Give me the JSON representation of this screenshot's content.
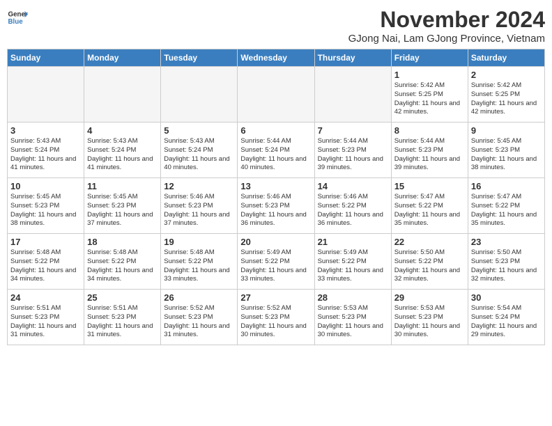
{
  "header": {
    "logo_line1": "General",
    "logo_line2": "Blue",
    "month": "November 2024",
    "location": "GJong Nai, Lam GJong Province, Vietnam"
  },
  "weekdays": [
    "Sunday",
    "Monday",
    "Tuesday",
    "Wednesday",
    "Thursday",
    "Friday",
    "Saturday"
  ],
  "weeks": [
    [
      {
        "day": "",
        "empty": true
      },
      {
        "day": "",
        "empty": true
      },
      {
        "day": "",
        "empty": true
      },
      {
        "day": "",
        "empty": true
      },
      {
        "day": "",
        "empty": true
      },
      {
        "day": "1",
        "sunrise": "5:42 AM",
        "sunset": "5:25 PM",
        "daylight": "11 hours and 42 minutes."
      },
      {
        "day": "2",
        "sunrise": "5:42 AM",
        "sunset": "5:25 PM",
        "daylight": "11 hours and 42 minutes."
      }
    ],
    [
      {
        "day": "3",
        "sunrise": "5:43 AM",
        "sunset": "5:24 PM",
        "daylight": "11 hours and 41 minutes."
      },
      {
        "day": "4",
        "sunrise": "5:43 AM",
        "sunset": "5:24 PM",
        "daylight": "11 hours and 41 minutes."
      },
      {
        "day": "5",
        "sunrise": "5:43 AM",
        "sunset": "5:24 PM",
        "daylight": "11 hours and 40 minutes."
      },
      {
        "day": "6",
        "sunrise": "5:44 AM",
        "sunset": "5:24 PM",
        "daylight": "11 hours and 40 minutes."
      },
      {
        "day": "7",
        "sunrise": "5:44 AM",
        "sunset": "5:23 PM",
        "daylight": "11 hours and 39 minutes."
      },
      {
        "day": "8",
        "sunrise": "5:44 AM",
        "sunset": "5:23 PM",
        "daylight": "11 hours and 39 minutes."
      },
      {
        "day": "9",
        "sunrise": "5:45 AM",
        "sunset": "5:23 PM",
        "daylight": "11 hours and 38 minutes."
      }
    ],
    [
      {
        "day": "10",
        "sunrise": "5:45 AM",
        "sunset": "5:23 PM",
        "daylight": "11 hours and 38 minutes."
      },
      {
        "day": "11",
        "sunrise": "5:45 AM",
        "sunset": "5:23 PM",
        "daylight": "11 hours and 37 minutes."
      },
      {
        "day": "12",
        "sunrise": "5:46 AM",
        "sunset": "5:23 PM",
        "daylight": "11 hours and 37 minutes."
      },
      {
        "day": "13",
        "sunrise": "5:46 AM",
        "sunset": "5:23 PM",
        "daylight": "11 hours and 36 minutes."
      },
      {
        "day": "14",
        "sunrise": "5:46 AM",
        "sunset": "5:22 PM",
        "daylight": "11 hours and 36 minutes."
      },
      {
        "day": "15",
        "sunrise": "5:47 AM",
        "sunset": "5:22 PM",
        "daylight": "11 hours and 35 minutes."
      },
      {
        "day": "16",
        "sunrise": "5:47 AM",
        "sunset": "5:22 PM",
        "daylight": "11 hours and 35 minutes."
      }
    ],
    [
      {
        "day": "17",
        "sunrise": "5:48 AM",
        "sunset": "5:22 PM",
        "daylight": "11 hours and 34 minutes."
      },
      {
        "day": "18",
        "sunrise": "5:48 AM",
        "sunset": "5:22 PM",
        "daylight": "11 hours and 34 minutes."
      },
      {
        "day": "19",
        "sunrise": "5:48 AM",
        "sunset": "5:22 PM",
        "daylight": "11 hours and 33 minutes."
      },
      {
        "day": "20",
        "sunrise": "5:49 AM",
        "sunset": "5:22 PM",
        "daylight": "11 hours and 33 minutes."
      },
      {
        "day": "21",
        "sunrise": "5:49 AM",
        "sunset": "5:22 PM",
        "daylight": "11 hours and 33 minutes."
      },
      {
        "day": "22",
        "sunrise": "5:50 AM",
        "sunset": "5:22 PM",
        "daylight": "11 hours and 32 minutes."
      },
      {
        "day": "23",
        "sunrise": "5:50 AM",
        "sunset": "5:23 PM",
        "daylight": "11 hours and 32 minutes."
      }
    ],
    [
      {
        "day": "24",
        "sunrise": "5:51 AM",
        "sunset": "5:23 PM",
        "daylight": "11 hours and 31 minutes."
      },
      {
        "day": "25",
        "sunrise": "5:51 AM",
        "sunset": "5:23 PM",
        "daylight": "11 hours and 31 minutes."
      },
      {
        "day": "26",
        "sunrise": "5:52 AM",
        "sunset": "5:23 PM",
        "daylight": "11 hours and 31 minutes."
      },
      {
        "day": "27",
        "sunrise": "5:52 AM",
        "sunset": "5:23 PM",
        "daylight": "11 hours and 30 minutes."
      },
      {
        "day": "28",
        "sunrise": "5:53 AM",
        "sunset": "5:23 PM",
        "daylight": "11 hours and 30 minutes."
      },
      {
        "day": "29",
        "sunrise": "5:53 AM",
        "sunset": "5:23 PM",
        "daylight": "11 hours and 30 minutes."
      },
      {
        "day": "30",
        "sunrise": "5:54 AM",
        "sunset": "5:24 PM",
        "daylight": "11 hours and 29 minutes."
      }
    ]
  ]
}
